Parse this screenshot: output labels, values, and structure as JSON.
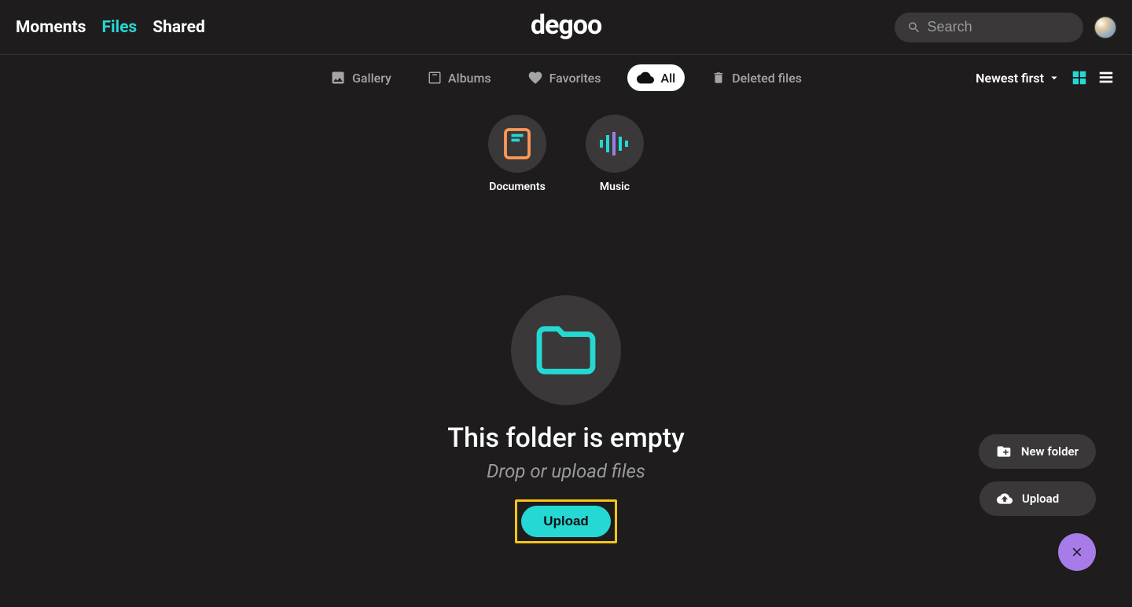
{
  "nav": {
    "moments": "Moments",
    "files": "Files",
    "shared": "Shared"
  },
  "logo": "degoo",
  "search": {
    "placeholder": "Search"
  },
  "filters": {
    "gallery": "Gallery",
    "albums": "Albums",
    "favorites": "Favorites",
    "all": "All",
    "deleted": "Deleted files"
  },
  "sort": {
    "label": "Newest first"
  },
  "categories": {
    "documents": "Documents",
    "music": "Music"
  },
  "empty": {
    "title": "This folder is empty",
    "subtitle": "Drop or upload files",
    "upload_label": "Upload"
  },
  "fab": {
    "new_folder": "New folder",
    "upload": "Upload"
  }
}
